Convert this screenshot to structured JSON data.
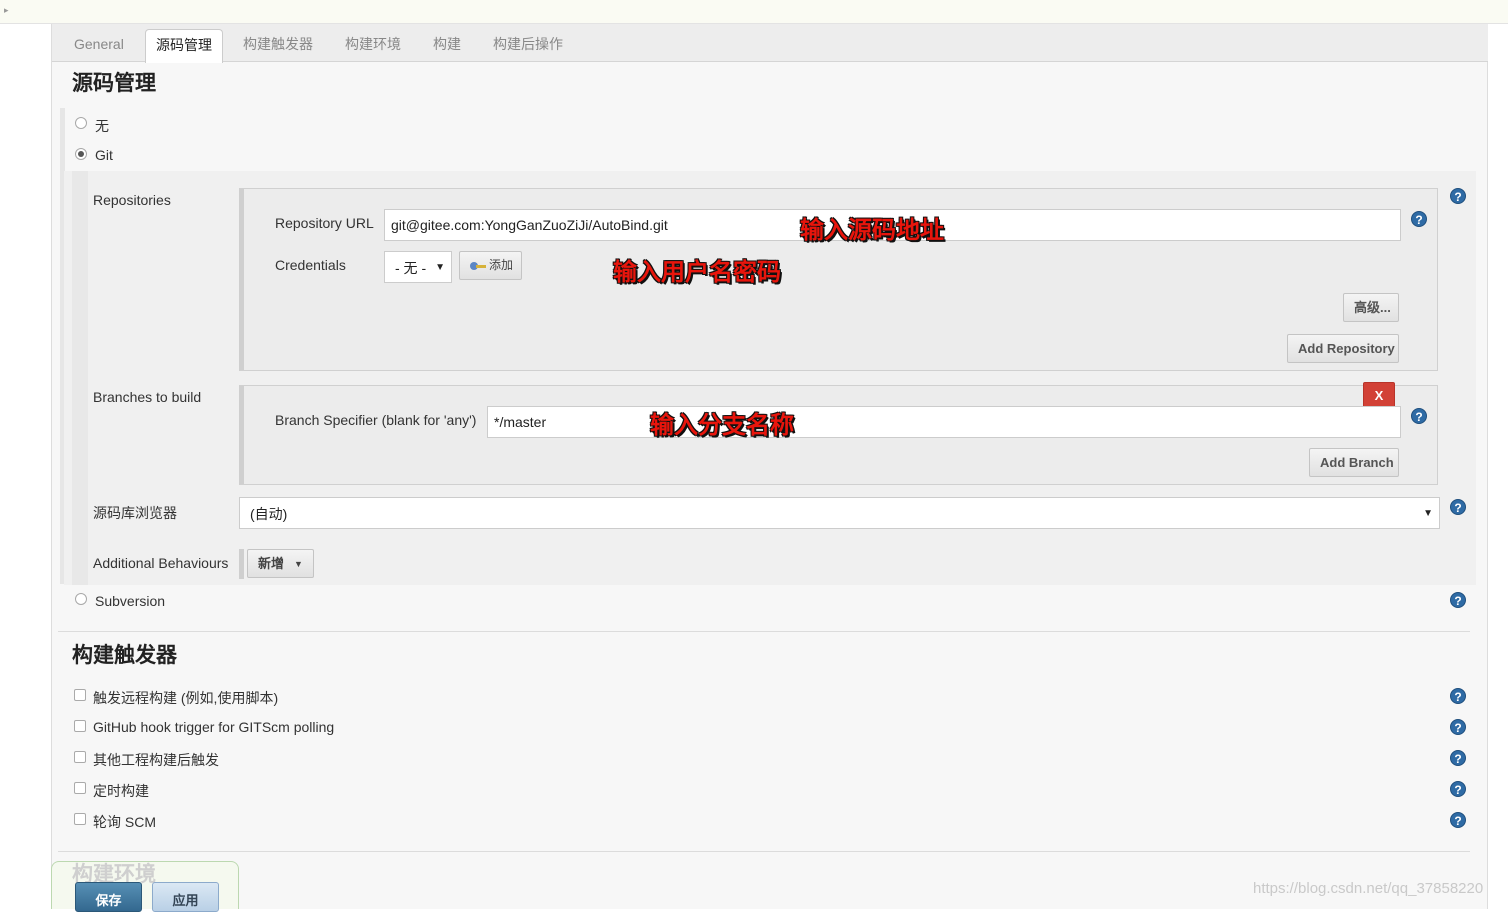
{
  "tabs": [
    {
      "label": "General"
    },
    {
      "label": "源码管理"
    },
    {
      "label": "构建触发器"
    },
    {
      "label": "构建环境"
    },
    {
      "label": "构建"
    },
    {
      "label": "构建后操作"
    }
  ],
  "scm": {
    "title": "源码管理",
    "options": {
      "none": "无",
      "git": "Git",
      "svn": "Subversion"
    },
    "selected": "Git",
    "repositories_label": "Repositories",
    "repo_url_label": "Repository URL",
    "repo_url_value": "git@gitee.com:YongGanZuoZiJi/AutoBind.git",
    "credentials_label": "Credentials",
    "credentials_value": "- 无 -",
    "add_credential_label": "添加",
    "advanced_label": "高级...",
    "add_repository_label": "Add Repository",
    "branches_label": "Branches to build",
    "branch_specifier_label": "Branch Specifier (blank for 'any')",
    "branch_value": "*/master",
    "delete_branch_label": "X",
    "add_branch_label": "Add Branch",
    "browser_label": "源码库浏览器",
    "browser_value": "(自动)",
    "behaviours_label": "Additional Behaviours",
    "behaviours_add_label": "新增"
  },
  "annotations": {
    "url": "输入源码地址",
    "credentials": "输入用户名密码",
    "branch": "输入分支名称"
  },
  "triggers": {
    "title": "构建触发器",
    "items": [
      {
        "label": "触发远程构建 (例如,使用脚本)"
      },
      {
        "label": "GitHub hook trigger for GITScm polling"
      },
      {
        "label": "其他工程构建后触发"
      },
      {
        "label": "定时构建"
      },
      {
        "label": "轮询 SCM"
      }
    ]
  },
  "build_env": {
    "title": "构建环境"
  },
  "footer": {
    "save_label": "保存",
    "apply_label": "应用"
  },
  "watermark": "https://blog.csdn.net/qq_37858220",
  "colors": {
    "help_icon": "#2f6ba5",
    "delete_button": "#d24136",
    "annotation": "#e8150c",
    "save_button": "#33688f"
  }
}
